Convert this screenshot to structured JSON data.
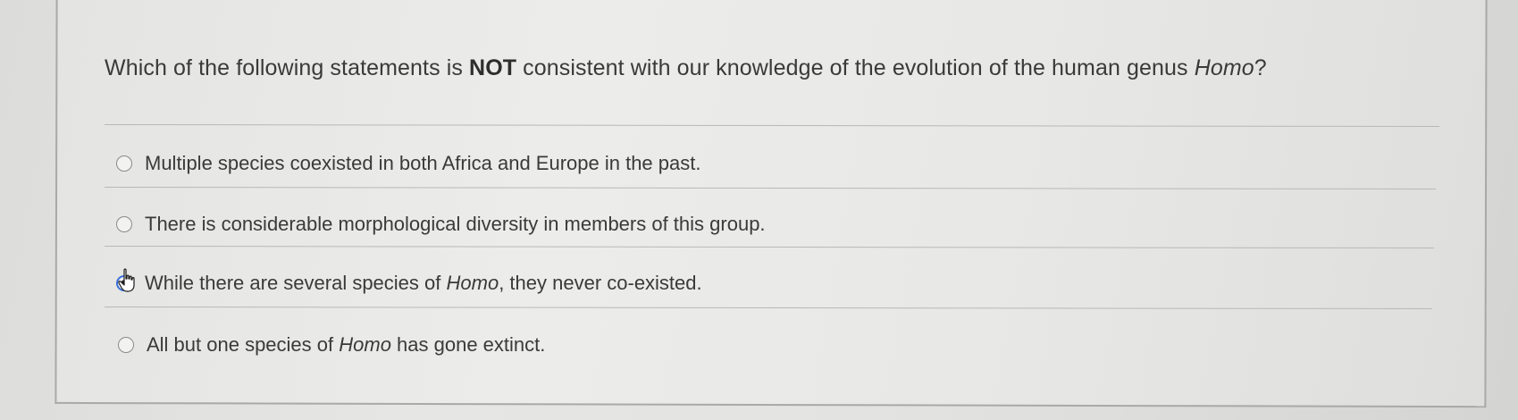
{
  "question": {
    "prefix": "Which of the following statements is ",
    "emphasis": "NOT",
    "middle": " consistent with our knowledge of the evolution of the human genus ",
    "italic": "Homo",
    "suffix": "?"
  },
  "options": [
    {
      "text_before": "Multiple species coexisted in both Africa and Europe in the past.",
      "italic": "",
      "text_after": "",
      "selected": false
    },
    {
      "text_before": "There is considerable morphological diversity in members of this group.",
      "italic": "",
      "text_after": "",
      "selected": false
    },
    {
      "text_before": "While there are several species of ",
      "italic": "Homo",
      "text_after": ", they never co-existed.",
      "selected": true
    },
    {
      "text_before": "All but one species of ",
      "italic": "Homo",
      "text_after": " has gone extinct.",
      "selected": false
    }
  ],
  "colors": {
    "selected_ring": "#3a6fd8",
    "text": "#3a3a3a"
  },
  "icons": {
    "cursor": "hand-pointer-icon"
  }
}
